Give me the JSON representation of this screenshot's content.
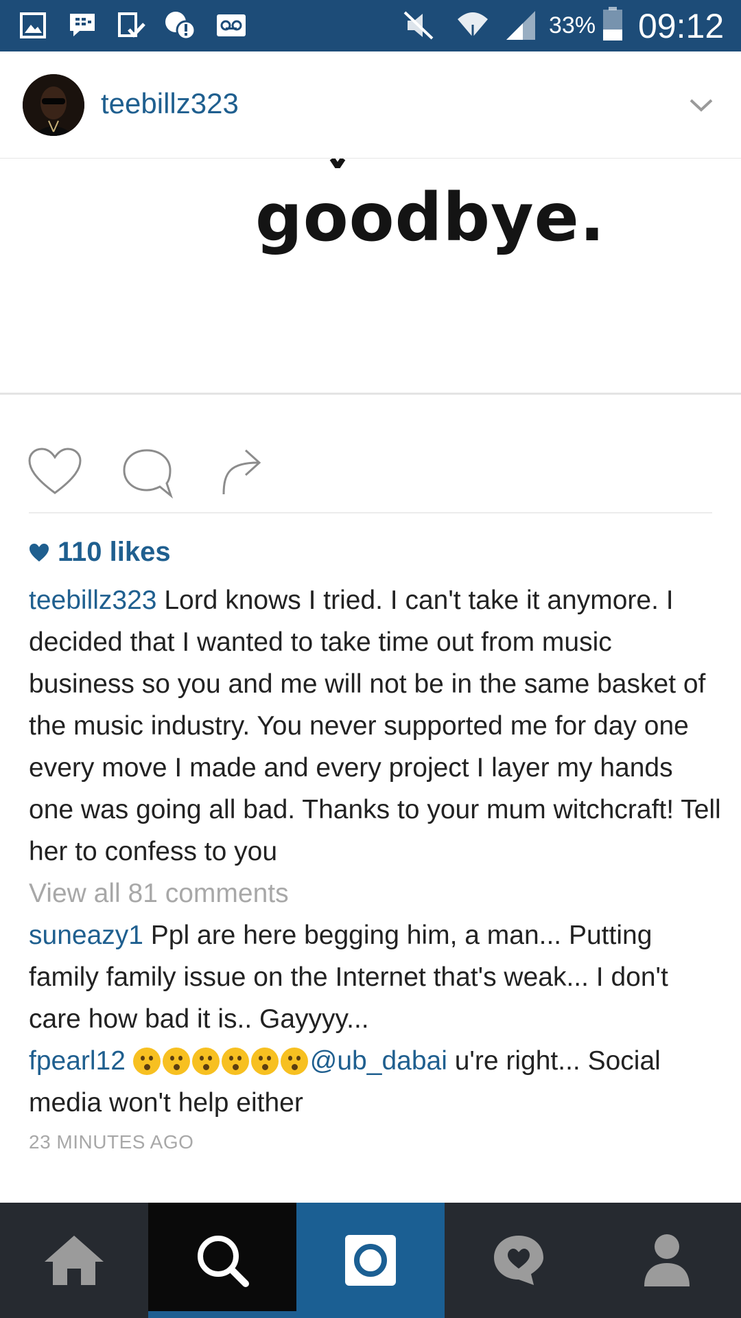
{
  "status_bar": {
    "battery_percent": "33%",
    "time": "09:12",
    "icons": [
      "gallery-icon",
      "bbm-icon",
      "download-done-icon",
      "alert-bubble-icon",
      "voicemail-icon",
      "mute-icon",
      "wifi-icon",
      "signal-icon",
      "battery-icon"
    ]
  },
  "header": {
    "username": "teebillz323",
    "menu_icon": "chevron-down-icon"
  },
  "post": {
    "image_text": "goodbye.",
    "like_count": "110 likes",
    "caption": {
      "username": "teebillz323",
      "text": "Lord knows I tried. I can't take it anymore. I decided that I wanted to take time out from music business so you and me will not be in the same basket of the music industry. You never supported me for day one every move I made and every project I layer my hands one was going all bad. Thanks to your mum witchcraft! Tell her to confess to you"
    },
    "view_all_comments": "View all 81 comments",
    "comments": [
      {
        "username": "suneazy1",
        "text": "Ppl are here begging him, a man... Putting family family issue on the Internet that's weak... I don't care how bad it is.. Gayyyy..."
      },
      {
        "username": "fpearl12",
        "mention": "@ub_dabai",
        "text": "u're right... Social media won't help either"
      }
    ],
    "time_ago": "23 MINUTES AGO"
  },
  "nav": {
    "items": [
      "home",
      "search",
      "camera",
      "activity",
      "profile"
    ],
    "active": "search"
  },
  "colors": {
    "status_bar": "#1d4c78",
    "username_blue": "#1f5f8f",
    "nav_bg": "#262a30",
    "nav_camera": "#1b5f93"
  }
}
